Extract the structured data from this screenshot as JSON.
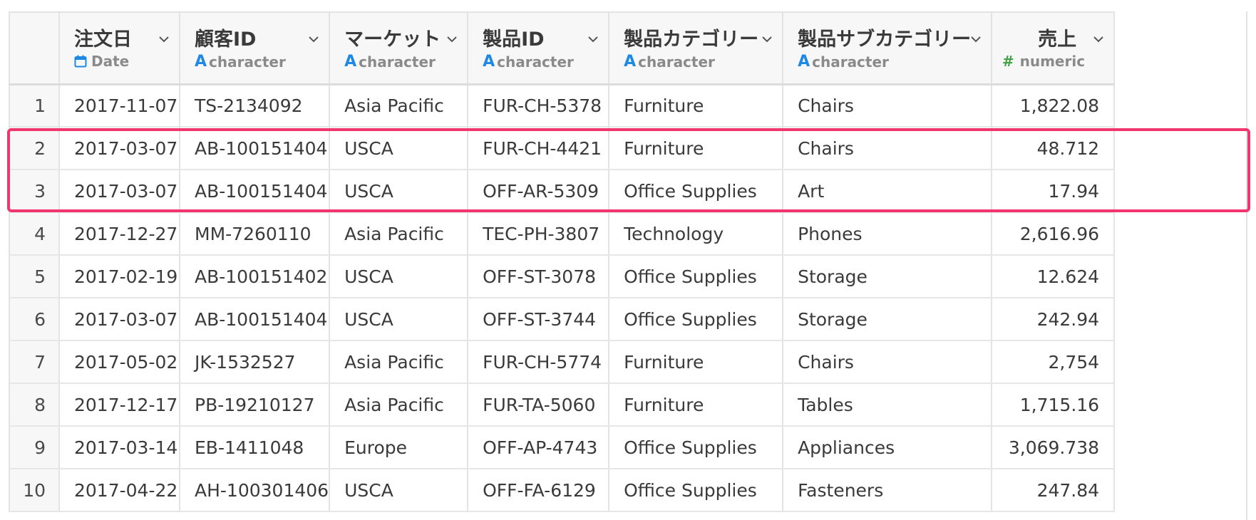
{
  "columns": [
    {
      "name": "注文日",
      "type": "Date",
      "type_icon": "calendar-icon"
    },
    {
      "name": "顧客ID",
      "type": "character",
      "type_icon": "A"
    },
    {
      "name": "マーケット",
      "type": "character",
      "type_icon": "A"
    },
    {
      "name": "製品ID",
      "type": "character",
      "type_icon": "A"
    },
    {
      "name": "製品カテゴリー",
      "type": "character",
      "type_icon": "A"
    },
    {
      "name": "製品サブカテゴリー",
      "type": "character",
      "type_icon": "A"
    },
    {
      "name": "売上",
      "type": "numeric",
      "type_icon": "#"
    }
  ],
  "rows": [
    {
      "idx": "1",
      "cells": [
        "2017-11-07",
        "TS-2134092",
        "Asia Pacific",
        "FUR-CH-5378",
        "Furniture",
        "Chairs",
        "1,822.08"
      ]
    },
    {
      "idx": "2",
      "cells": [
        "2017-03-07",
        "AB-100151404",
        "USCA",
        "FUR-CH-4421",
        "Furniture",
        "Chairs",
        "48.712"
      ]
    },
    {
      "idx": "3",
      "cells": [
        "2017-03-07",
        "AB-100151404",
        "USCA",
        "OFF-AR-5309",
        "Office Supplies",
        "Art",
        "17.94"
      ]
    },
    {
      "idx": "4",
      "cells": [
        "2017-12-27",
        "MM-7260110",
        "Asia Pacific",
        "TEC-PH-3807",
        "Technology",
        "Phones",
        "2,616.96"
      ]
    },
    {
      "idx": "5",
      "cells": [
        "2017-02-19",
        "AB-100151402",
        "USCA",
        "OFF-ST-3078",
        "Office Supplies",
        "Storage",
        "12.624"
      ]
    },
    {
      "idx": "6",
      "cells": [
        "2017-03-07",
        "AB-100151404",
        "USCA",
        "OFF-ST-3744",
        "Office Supplies",
        "Storage",
        "242.94"
      ]
    },
    {
      "idx": "7",
      "cells": [
        "2017-05-02",
        "JK-1532527",
        "Asia Pacific",
        "FUR-CH-5774",
        "Furniture",
        "Chairs",
        "2,754"
      ]
    },
    {
      "idx": "8",
      "cells": [
        "2017-12-17",
        "PB-19210127",
        "Asia Pacific",
        "FUR-TA-5060",
        "Furniture",
        "Tables",
        "1,715.16"
      ]
    },
    {
      "idx": "9",
      "cells": [
        "2017-03-14",
        "EB-1411048",
        "Europe",
        "OFF-AP-4743",
        "Office Supplies",
        "Appliances",
        "3,069.738"
      ]
    },
    {
      "idx": "10",
      "cells": [
        "2017-04-22",
        "AH-100301406",
        "USCA",
        "OFF-FA-6129",
        "Office Supplies",
        "Fasteners",
        "247.84"
      ]
    }
  ],
  "highlight_color": "#f0356f",
  "colors": {
    "character_icon": "#1e88e5",
    "numeric_icon": "#43a047",
    "date_icon": "#1e88e5"
  }
}
